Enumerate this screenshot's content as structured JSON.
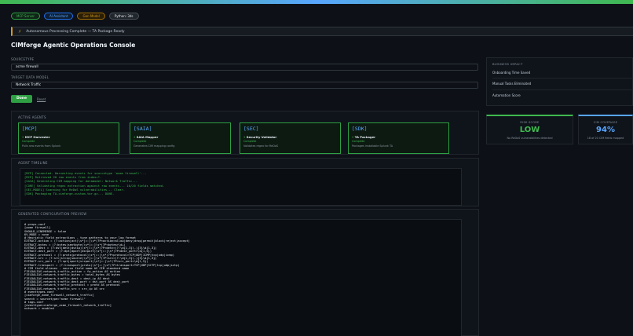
{
  "status_pills": [
    {
      "label": "MCP Server",
      "color": "green"
    },
    {
      "label": "AI Assistant",
      "color": "blue"
    },
    {
      "label": "Gen Model",
      "color": "amber"
    },
    {
      "label": "Python: 3ds",
      "color": "gray"
    }
  ],
  "banner": {
    "text": "Autonomous Processing Complete — TA Package Ready"
  },
  "page_title": "CIMforge Agentic Operations Console",
  "sourcetype": {
    "label": "SOURCETYPE",
    "value": "acme firewall"
  },
  "datamodel": {
    "label": "TARGET DATA MODEL",
    "value": "Network Traffic"
  },
  "buttons": {
    "done": "Done",
    "reset": "Reset"
  },
  "agents_section": {
    "title": "ACTIVE AGENTS",
    "agents": [
      {
        "tag": "[MCP]",
        "name": "MCP Harvester",
        "status": "Complete",
        "desc": "Pulls raw events from Splunk"
      },
      {
        "tag": "[SAIA]",
        "name": "SAIA Mapper",
        "status": "Complete",
        "desc": "Generates CIM mapping config"
      },
      {
        "tag": "[SEC]",
        "name": "Security Validator",
        "status": "Complete",
        "desc": "Validates regex for ReDoS"
      },
      {
        "tag": "[SDK]",
        "name": "TA Packager",
        "status": "Complete",
        "desc": "Packages installable Splunk TA"
      }
    ]
  },
  "timeline": {
    "title": "AGENT TIMELINE",
    "lines": [
      "[MCP] Connected. Harvesting events for sourcetype 'acme firewall'...",
      "[MCP] Retrieved 20 raw events from index=*.",
      "[SAIA] Generating CIM mapping for datamodel: Network Traffic...",
      "[CORE] Validating regex extraction against raw events... 10/20 fields matched.",
      "[SEC-MODEL] Scanning for ReDoS vulnerabilities... Clear.",
      "[SDK] Packaging TA-cimforge-custom.tar.gz... DONE."
    ]
  },
  "preview": {
    "title": "GENERATED CONFIGURATION PREVIEW",
    "lines": [
      "# props.conf",
      "[acme firewall]",
      "SHOULD_LINEMERGE = false",
      "KV_MODE = none",
      "",
      "# Heuristic field extractions - tune patterns to your log format",
      "EXTRACT-action = (?:action|act)\\s*[=:]\\s*(?P<action>allow|deny|drop|permit|block|reject|accept)",
      "EXTRACT-bytes = (?:bytes|sentbyte)\\s*[=:]\\s*(?P<bytes>\\d+)",
      "EXTRACT-dest = (?:dst|dest|dstip)\\s*[=:]\\s*(?P<dest>(?:\\d{1,3}\\.){3}\\d{1,3})",
      "EXTRACT-dest_port = (?:dpt|dport|dstport)\\s*[=:]\\s*(?P<dest_port>\\d{1,5})",
      "EXTRACT-protocol = (?:proto|protocol)\\s*[=:]\\s*(?P<protocol>TCP|UDP|ICMP|tcp|udp|icmp)",
      "EXTRACT-src = (?:src|srcip|source)\\s*[=:]\\s*(?P<src>(?:\\d{1,3}\\.){3}\\d{1,3})",
      "EXTRACT-src_port = (?:spt|sport|srcport)\\s*[=:]\\s*(?P<src_port>\\d{1,5})",
      "EXTRACT-transport = (?:transport|proto)\\s*[=:]\\s*(?P<transport>TCP|UDP|SCTP|tcp|udp|sctp)",
      "",
      "# CIM field aliases - source field name AS CIM standard name",
      "FIELDALIAS-network_traffic_action = fw_action AS action",
      "FIELDALIAS-network_traffic_bytes = total_bytes AS bytes",
      "FIELDALIAS-network_traffic_dest = dest_ip AS dest",
      "FIELDALIAS-network_traffic_dest_port = dst_port AS dest_port",
      "FIELDALIAS-network_traffic_protocol = proto AS protocol",
      "FIELDALIAS-network_traffic_src = src_ip AS src",
      "",
      "# eventtypes.conf",
      "[cimforge_acme_firewall_network_traffic]",
      "search = sourcetype=\"acme firewall\"",
      "",
      "# tags.conf",
      "[eventtype=cimforge_acme_firewall_network_traffic]",
      "network = enabled"
    ]
  },
  "business_impact": {
    "title": "BUSINESS IMPACT",
    "rows": [
      "Onboarding Time Saved",
      "Manual Tasks Eliminated",
      "Automation Score"
    ]
  },
  "risk_card": {
    "title": "RISK SCORE",
    "value": "LOW",
    "sub": "No ReDoS vulnerabilities detected",
    "color": "#3fb950"
  },
  "cim_card": {
    "title": "CIM COVERAGE",
    "value": "94%",
    "sub": "18 of 20 CIM fields mapped",
    "color": "#58a6ff"
  }
}
